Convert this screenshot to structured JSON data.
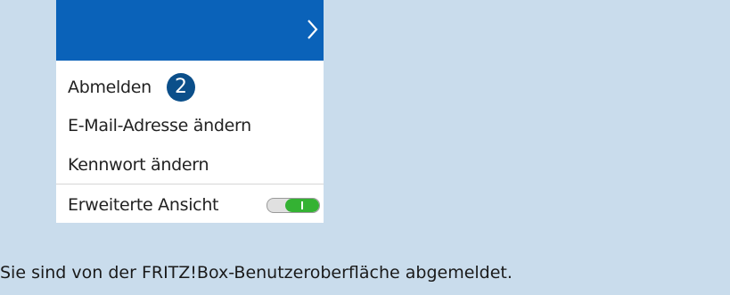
{
  "menu": {
    "header_icon": "chevron-right-icon",
    "items": [
      {
        "label": "Abmelden",
        "step": "2"
      },
      {
        "label": "E-Mail-Adresse ändern"
      },
      {
        "label": "Kennwort ändern"
      },
      {
        "label": "Erweiterte Ansicht",
        "toggle_on": true
      }
    ]
  },
  "message": "Sie sind von der FRITZ!Box-Benutzeroberfläche abgemeldet.",
  "colors": {
    "background": "#c9dcec",
    "header": "#0a62b9",
    "badge": "#0b4f8a",
    "toggle_on": "#34b233"
  }
}
